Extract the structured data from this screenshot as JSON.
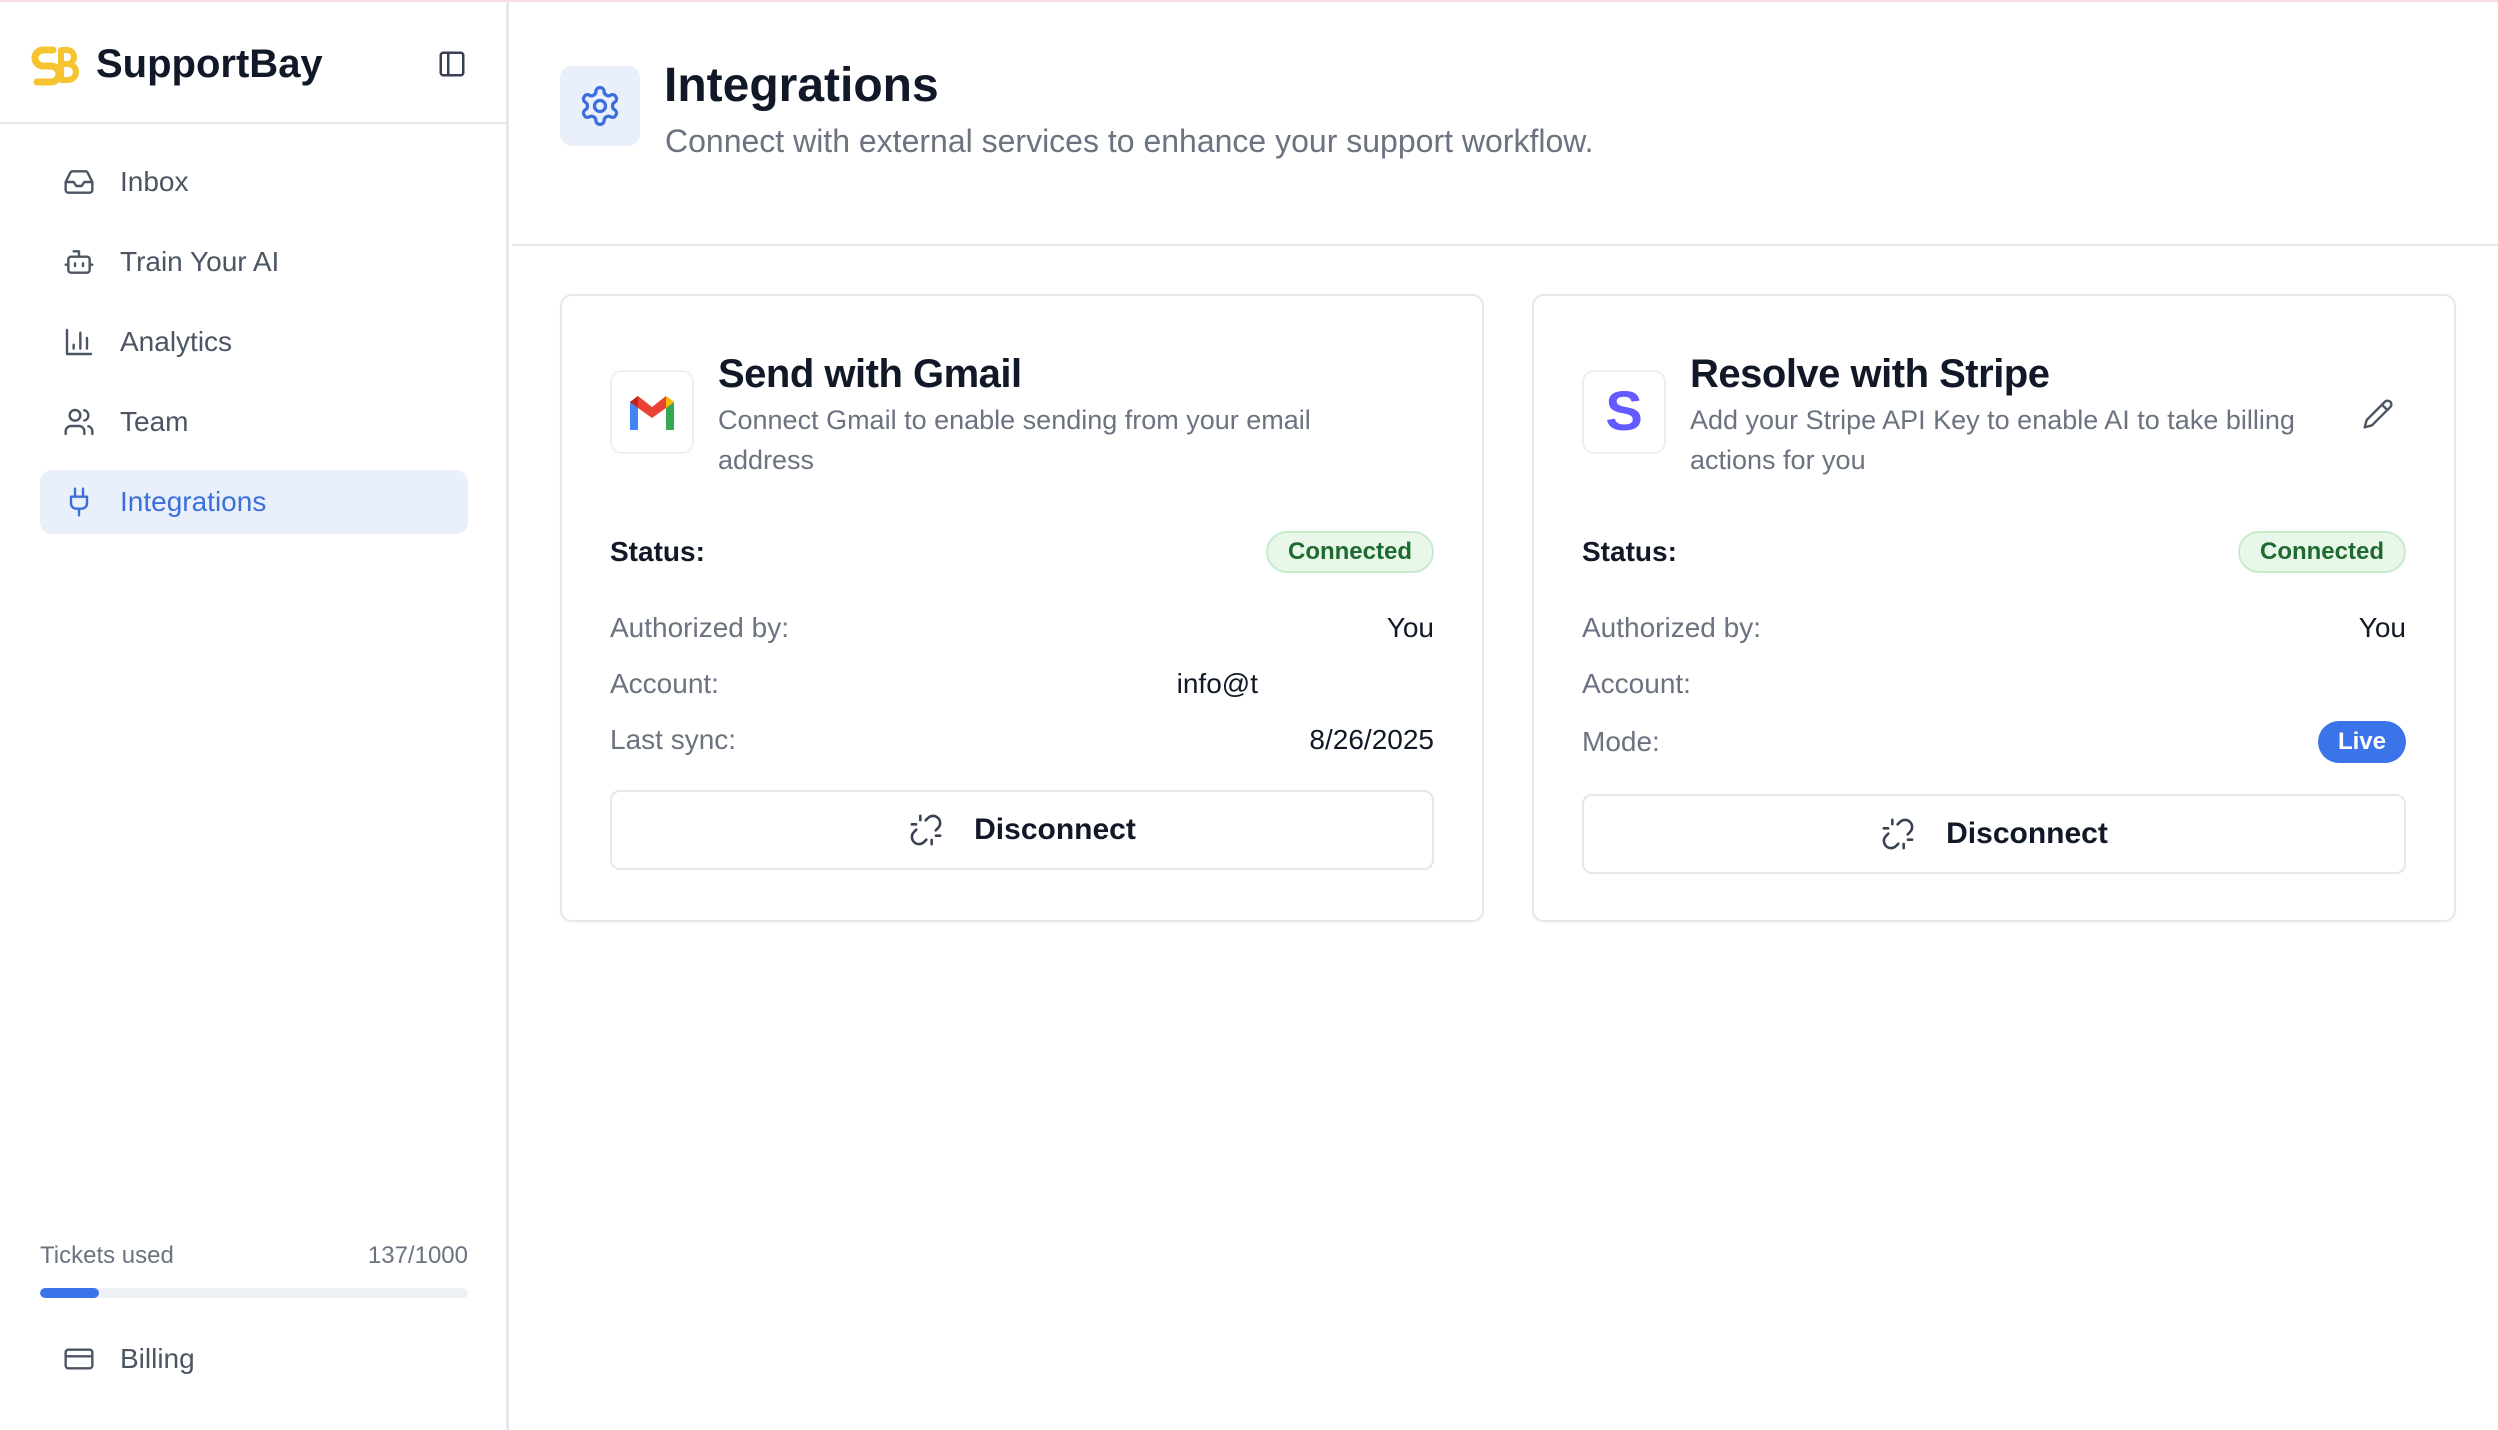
{
  "app": {
    "name": "SupportBay"
  },
  "sidebar": {
    "items": [
      {
        "label": "Inbox",
        "icon": "inbox-icon"
      },
      {
        "label": "Train Your AI",
        "icon": "bot-icon"
      },
      {
        "label": "Analytics",
        "icon": "bar-chart-icon"
      },
      {
        "label": "Team",
        "icon": "users-icon"
      },
      {
        "label": "Integrations",
        "icon": "plug-icon",
        "active": true
      }
    ],
    "usage": {
      "label": "Tickets used",
      "count": "137/1000",
      "used": 137,
      "limit": 1000
    },
    "billing_label": "Billing"
  },
  "header": {
    "title": "Integrations",
    "subtitle": "Connect with external services to enhance your support workflow."
  },
  "integrations": {
    "gmail": {
      "title": "Send with Gmail",
      "description": "Connect Gmail to enable sending from your email address",
      "status_label": "Status:",
      "status": "Connected",
      "authorized_by_label": "Authorized by:",
      "authorized_by": "You",
      "account_label": "Account:",
      "account": "info@t",
      "last_sync_label": "Last sync:",
      "last_sync": "8/26/2025",
      "disconnect_label": "Disconnect"
    },
    "stripe": {
      "title": "Resolve with Stripe",
      "description": "Add your Stripe API Key to enable AI to take billing actions for you",
      "status_label": "Status:",
      "status": "Connected",
      "authorized_by_label": "Authorized by:",
      "authorized_by": "You",
      "account_label": "Account:",
      "account": "",
      "mode_label": "Mode:",
      "mode": "Live",
      "disconnect_label": "Disconnect"
    }
  },
  "colors": {
    "accent": "#3b74e8",
    "active_bg": "#eaf0fb",
    "connected_bg": "#e8f7ea",
    "connected_text": "#1f6b2f",
    "brand_yellow": "#f6c431",
    "stripe_purple": "#635bff"
  }
}
